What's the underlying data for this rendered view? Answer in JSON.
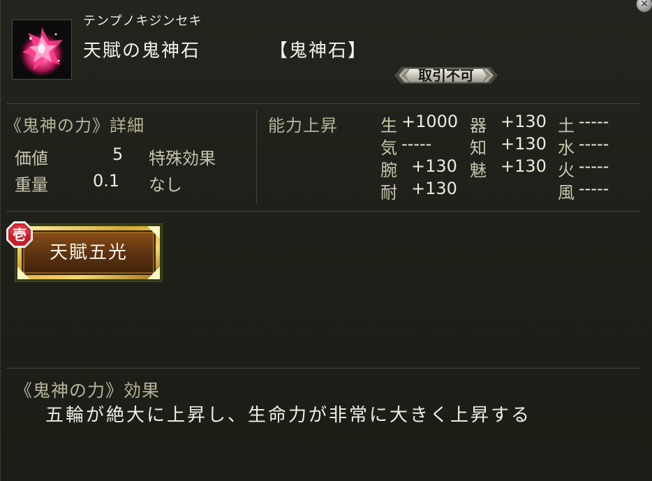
{
  "window": {
    "close_icon": "close-icon"
  },
  "item": {
    "icon": "crystal-gem-icon",
    "reading": "テンプノキジンセキ",
    "name": "天賦の鬼神石",
    "category": "【鬼神石】",
    "trade_status": "取引不可"
  },
  "details": {
    "title": "《鬼神の力》詳細",
    "value_label": "価値",
    "value": "5",
    "weight_label": "重量",
    "weight": "0.1",
    "special_label": "特殊効果",
    "special_value": "なし"
  },
  "ability": {
    "title": "能力上昇",
    "col1": [
      {
        "name": "生",
        "value": "+1000"
      },
      {
        "name": "気",
        "value": "-----"
      },
      {
        "name": "腕",
        "value": "+130"
      },
      {
        "name": "耐",
        "value": "+130"
      }
    ],
    "col2": [
      {
        "name": "器",
        "value": "+130"
      },
      {
        "name": "知",
        "value": "+130"
      },
      {
        "name": "魅",
        "value": "+130"
      }
    ],
    "col3": [
      {
        "name": "土",
        "value": "-----"
      },
      {
        "name": "水",
        "value": "-----"
      },
      {
        "name": "火",
        "value": "-----"
      },
      {
        "name": "風",
        "value": "-----"
      }
    ]
  },
  "skill": {
    "rank": "壱",
    "label": "天賦五光",
    "colors": {
      "gold": "#c9a23a",
      "brown": "#6a3a10",
      "red_badge": "#c81e2a"
    }
  },
  "effect": {
    "title": "《鬼神の力》効果",
    "text": "五輪が絶大に上昇し、生命力が非常に大きく上昇する"
  }
}
